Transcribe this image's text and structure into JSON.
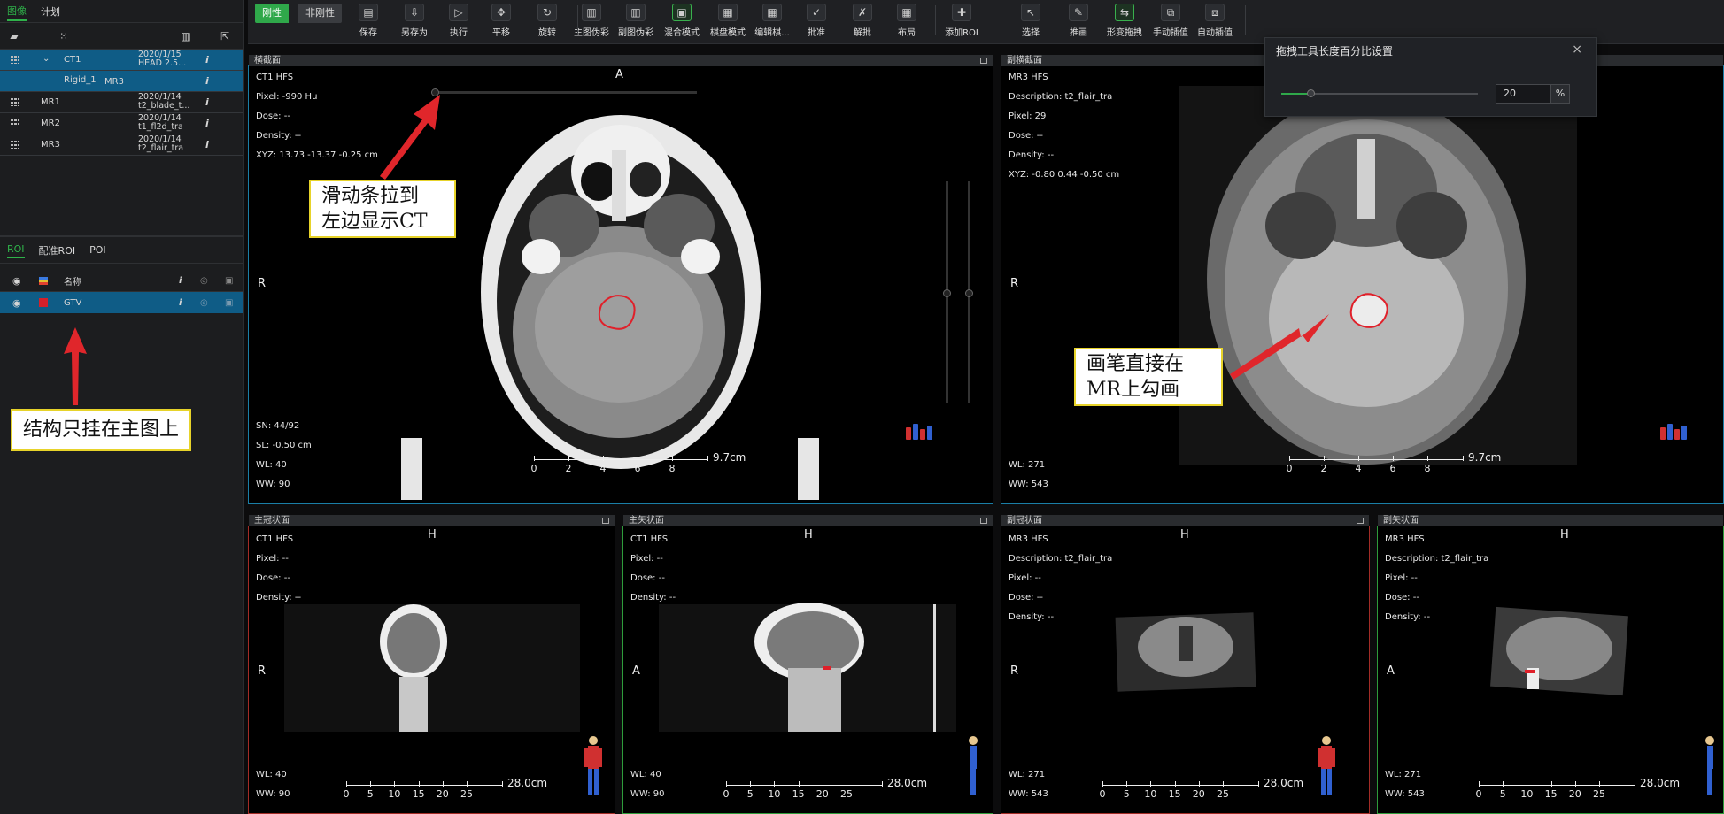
{
  "left_panel": {
    "tabs": [
      "图像",
      "计划"
    ],
    "images": [
      {
        "name": "CT1",
        "date": "2020/1/15",
        "desc": "HEAD 2.5...",
        "info": "i",
        "selected": true
      },
      {
        "name": "Rigid_1",
        "target": "MR3",
        "info": "i",
        "selected": true
      },
      {
        "name": "MR1",
        "date": "2020/1/14",
        "desc": "t2_blade_t...",
        "info": "i"
      },
      {
        "name": "MR2",
        "date": "2020/1/14",
        "desc": "t1_fl2d_tra",
        "info": "i"
      },
      {
        "name": "MR3",
        "date": "2020/1/14",
        "desc": "t2_flair_tra",
        "info": "i"
      }
    ],
    "roi_tabs": [
      "ROI",
      "配准ROI",
      "POI"
    ],
    "roi_header": {
      "name_label": "名称",
      "info": "i"
    },
    "roi_rows": [
      {
        "name": "GTV",
        "color": "#d4202a",
        "info": "i"
      }
    ],
    "note": "结构只挂在主图上"
  },
  "toolbar": {
    "modes": [
      "刚性",
      "非刚性"
    ],
    "buttons": [
      {
        "label": "保存",
        "icon": "save-icon"
      },
      {
        "label": "另存为",
        "icon": "save-as-icon"
      },
      {
        "label": "执行",
        "icon": "execute-icon"
      },
      {
        "label": "平移",
        "icon": "pan-icon"
      },
      {
        "label": "旋转",
        "icon": "rotate-icon"
      },
      {
        "label": "主图伪彩",
        "icon": "primary-pseudocolor-icon"
      },
      {
        "label": "副图伪彩",
        "icon": "secondary-pseudocolor-icon"
      },
      {
        "label": "混合模式",
        "icon": "blend-mode-icon",
        "active": true
      },
      {
        "label": "棋盘模式",
        "icon": "checkerboard-icon"
      },
      {
        "label": "编辑棋...",
        "icon": "edit-checkerboard-icon"
      },
      {
        "label": "批准",
        "icon": "approve-icon"
      },
      {
        "label": "解批",
        "icon": "unapprove-icon"
      },
      {
        "label": "布局",
        "icon": "layout-icon"
      },
      {
        "label": "添加ROI",
        "icon": "add-roi-icon"
      },
      {
        "label": "选择",
        "icon": "select-icon"
      },
      {
        "label": "推画",
        "icon": "push-draw-icon"
      },
      {
        "label": "形变拖拽",
        "icon": "deform-drag-icon",
        "active": true
      },
      {
        "label": "手动插值",
        "icon": "manual-interp-icon"
      },
      {
        "label": "自动插值",
        "icon": "auto-interp-icon"
      }
    ]
  },
  "popup": {
    "title": "拖拽工具长度百分比设置",
    "close": "×",
    "value": "20",
    "unit": "%",
    "level": 0.2
  },
  "viewports": {
    "axial_primary": {
      "title": "横截面",
      "orientation_top": "A",
      "orientation_left": "R",
      "info": [
        "CT1 HFS",
        "Pixel: -990 Hu",
        "Dose: --",
        "Density: --",
        "XYZ: 13.73 -13.37 -0.25 cm"
      ],
      "bottom": [
        "SN: 44/92",
        "SL: -0.50 cm",
        "WL: 40",
        "WW: 90"
      ],
      "scale_ticks": [
        "0",
        "2",
        "4",
        "6",
        "8"
      ],
      "scale_length": "9.7cm",
      "note": "滑动条拉到\n左边显示CT"
    },
    "axial_secondary": {
      "title": "副横截面",
      "orientation_left": "R",
      "info": [
        "MR3 HFS",
        "Description: t2_flair_tra",
        "Pixel: 29",
        "Dose: --",
        "Density: --",
        "XYZ: -0.80 0.44 -0.50 cm"
      ],
      "bottom": [
        "WL: 271",
        "WW: 543"
      ],
      "scale_ticks": [
        "0",
        "2",
        "4",
        "6",
        "8"
      ],
      "scale_length": "9.7cm",
      "note": "画笔直接在\nMR上勾画"
    },
    "coronal_primary": {
      "title": "主冠状面",
      "orientation_top": "H",
      "orientation_left": "R",
      "info": [
        "CT1 HFS",
        "Pixel: --",
        "Dose: --",
        "Density: --"
      ],
      "bottom": [
        "WL: 40",
        "WW: 90"
      ],
      "scale_ticks": [
        "0",
        "5",
        "10",
        "15",
        "20",
        "25"
      ],
      "scale_length": "28.0cm"
    },
    "sagittal_primary": {
      "title": "主矢状面",
      "orientation_top": "H",
      "orientation_left": "A",
      "info": [
        "CT1 HFS",
        "Pixel: --",
        "Dose: --",
        "Density: --"
      ],
      "bottom": [
        "WL: 40",
        "WW: 90"
      ],
      "scale_ticks": [
        "0",
        "5",
        "10",
        "15",
        "20",
        "25"
      ],
      "scale_length": "28.0cm"
    },
    "coronal_secondary": {
      "title": "副冠状面",
      "orientation_top": "H",
      "orientation_left": "R",
      "info": [
        "MR3 HFS",
        "Description: t2_flair_tra",
        "Pixel: --",
        "Dose: --",
        "Density: --"
      ],
      "bottom": [
        "WL: 271",
        "WW: 543"
      ],
      "scale_ticks": [
        "0",
        "5",
        "10",
        "15",
        "20",
        "25"
      ],
      "scale_length": "28.0cm"
    },
    "sagittal_secondary": {
      "title": "副矢状面",
      "orientation_top": "H",
      "orientation_left": "A",
      "info": [
        "MR3 HFS",
        "Description: t2_flair_tra",
        "Pixel: --",
        "Dose: --",
        "Density: --"
      ],
      "bottom": [
        "WL: 271",
        "WW: 543"
      ],
      "scale_ticks": [
        "0",
        "5",
        "10",
        "15",
        "20",
        "25"
      ],
      "scale_length": "28.0cm"
    }
  }
}
